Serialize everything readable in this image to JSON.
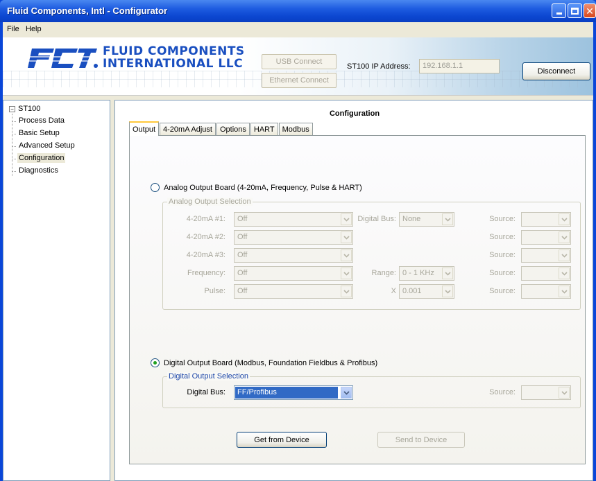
{
  "window": {
    "title": "Fluid Components, Intl - Configurator"
  },
  "menu": {
    "file": "File",
    "help": "Help"
  },
  "header": {
    "logo_line1": "FLUID COMPONENTS",
    "logo_line2": "INTERNATIONAL LLC",
    "usb_connect": "USB Connect",
    "ethernet_connect": "Ethernet Connect",
    "ip_label": "ST100 IP Address:",
    "ip_value": "192.168.1.1",
    "disconnect": "Disconnect"
  },
  "tree": {
    "root": "ST100",
    "items": [
      "Process Data",
      "Basic Setup",
      "Advanced Setup",
      "Configuration",
      "Diagnostics"
    ],
    "selected": "Configuration"
  },
  "main": {
    "title": "Configuration",
    "tabs": [
      "Output",
      "4-20mA Adjust",
      "Options",
      "HART",
      "Modbus"
    ],
    "active_tab": "Output"
  },
  "analog": {
    "radio_label": "Analog Output Board (4-20mA, Frequency, Pulse & HART)",
    "selected": false,
    "group_title": "Analog Output Selection",
    "rows": [
      {
        "label": "4-20mA #1:",
        "value": "Off"
      },
      {
        "label": "4-20mA #2:",
        "value": "Off"
      },
      {
        "label": "4-20mA #3:",
        "value": "Off"
      },
      {
        "label": "Frequency:",
        "value": "Off"
      },
      {
        "label": "Pulse:",
        "value": "Off"
      }
    ],
    "digital_bus_label": "Digital Bus:",
    "digital_bus_value": "None",
    "range_label": "Range:",
    "range_value": "0 - 1 KHz",
    "multiplier_label": "X",
    "multiplier_value": "0.001",
    "source_label": "Source:"
  },
  "digital": {
    "radio_label": "Digital Output Board (Modbus, Foundation Fieldbus & Profibus)",
    "selected": true,
    "group_title": "Digital Output Selection",
    "bus_label": "Digital Bus:",
    "bus_value": "FF/Profibus",
    "source_label": "Source:"
  },
  "actions": {
    "get": "Get from Device",
    "send": "Send to Device"
  },
  "colors": {
    "title_bar": "#0a46d8",
    "logo_blue": "#1a4fc0",
    "selection": "#316ac5",
    "group_title_blue": "#1c46a8"
  }
}
